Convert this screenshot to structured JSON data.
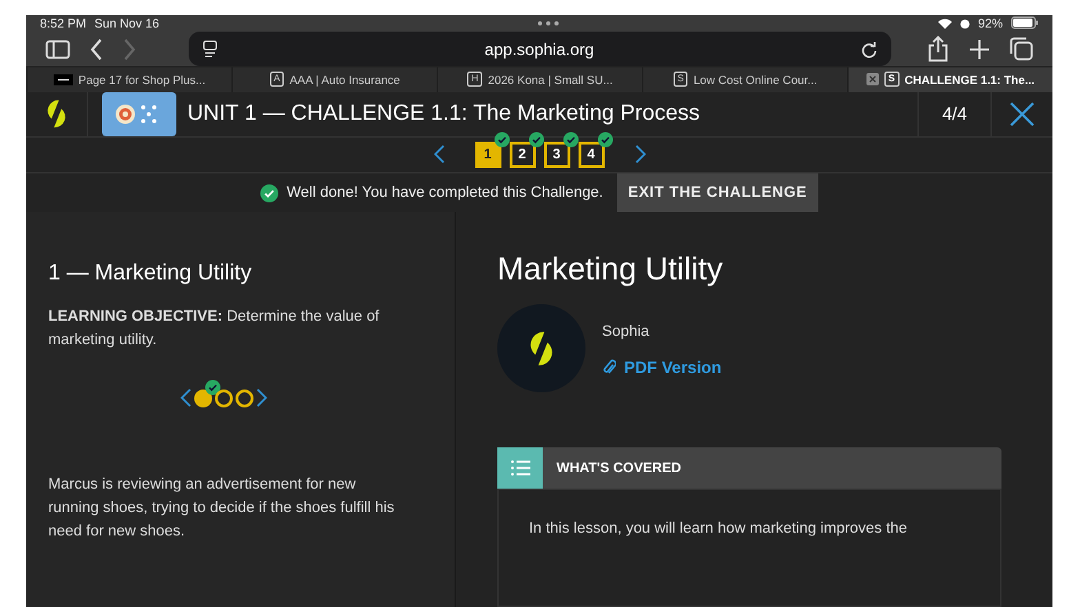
{
  "status_bar": {
    "time": "8:52 PM",
    "date": "Sun Nov 16",
    "battery": "92%"
  },
  "browser": {
    "url": "app.sophia.org",
    "tabs": [
      {
        "kind": "image",
        "title": "Page 17 for Shop Plus...",
        "selected": false
      },
      {
        "kind": "letter",
        "icon": "A",
        "title": "AAA | Auto Insurance",
        "selected": false
      },
      {
        "kind": "letter",
        "icon": "H",
        "title": "2026 Kona | Small SU...",
        "selected": false
      },
      {
        "kind": "letter",
        "icon": "S",
        "title": "Low Cost Online Cour...",
        "selected": false
      },
      {
        "kind": "letter",
        "icon": "S",
        "title": "CHALLENGE 1.1: The...",
        "selected": true
      }
    ]
  },
  "header": {
    "title": "UNIT 1 — CHALLENGE 1.1: The Marketing Process",
    "progress": "4/4"
  },
  "steps": [
    {
      "label": "1",
      "selected": true,
      "completed": true
    },
    {
      "label": "2",
      "selected": false,
      "completed": true
    },
    {
      "label": "3",
      "selected": false,
      "completed": true
    },
    {
      "label": "4",
      "selected": false,
      "completed": true
    }
  ],
  "banner": {
    "message": "Well done! You have completed this Challenge.",
    "button": "EXIT THE CHALLENGE"
  },
  "left": {
    "heading": "1 — Marketing Utility",
    "objective": "**LEARNING OBJECTIVE:** Determine the value of marketing utility.",
    "dots": [
      {
        "selected": true,
        "completed": true
      },
      {
        "selected": false,
        "completed": false
      },
      {
        "selected": false,
        "completed": false
      }
    ],
    "paragraph": "Marcus is reviewing an advertisement for new running shoes, trying to decide if the shoes fulfill his need for new shoes."
  },
  "right": {
    "title": "Marketing Utility",
    "author": "Sophia",
    "link": "PDF Version",
    "covered_heading": "WHAT'S COVERED",
    "covered_text": "In this lesson, you will learn how marketing improves the"
  }
}
